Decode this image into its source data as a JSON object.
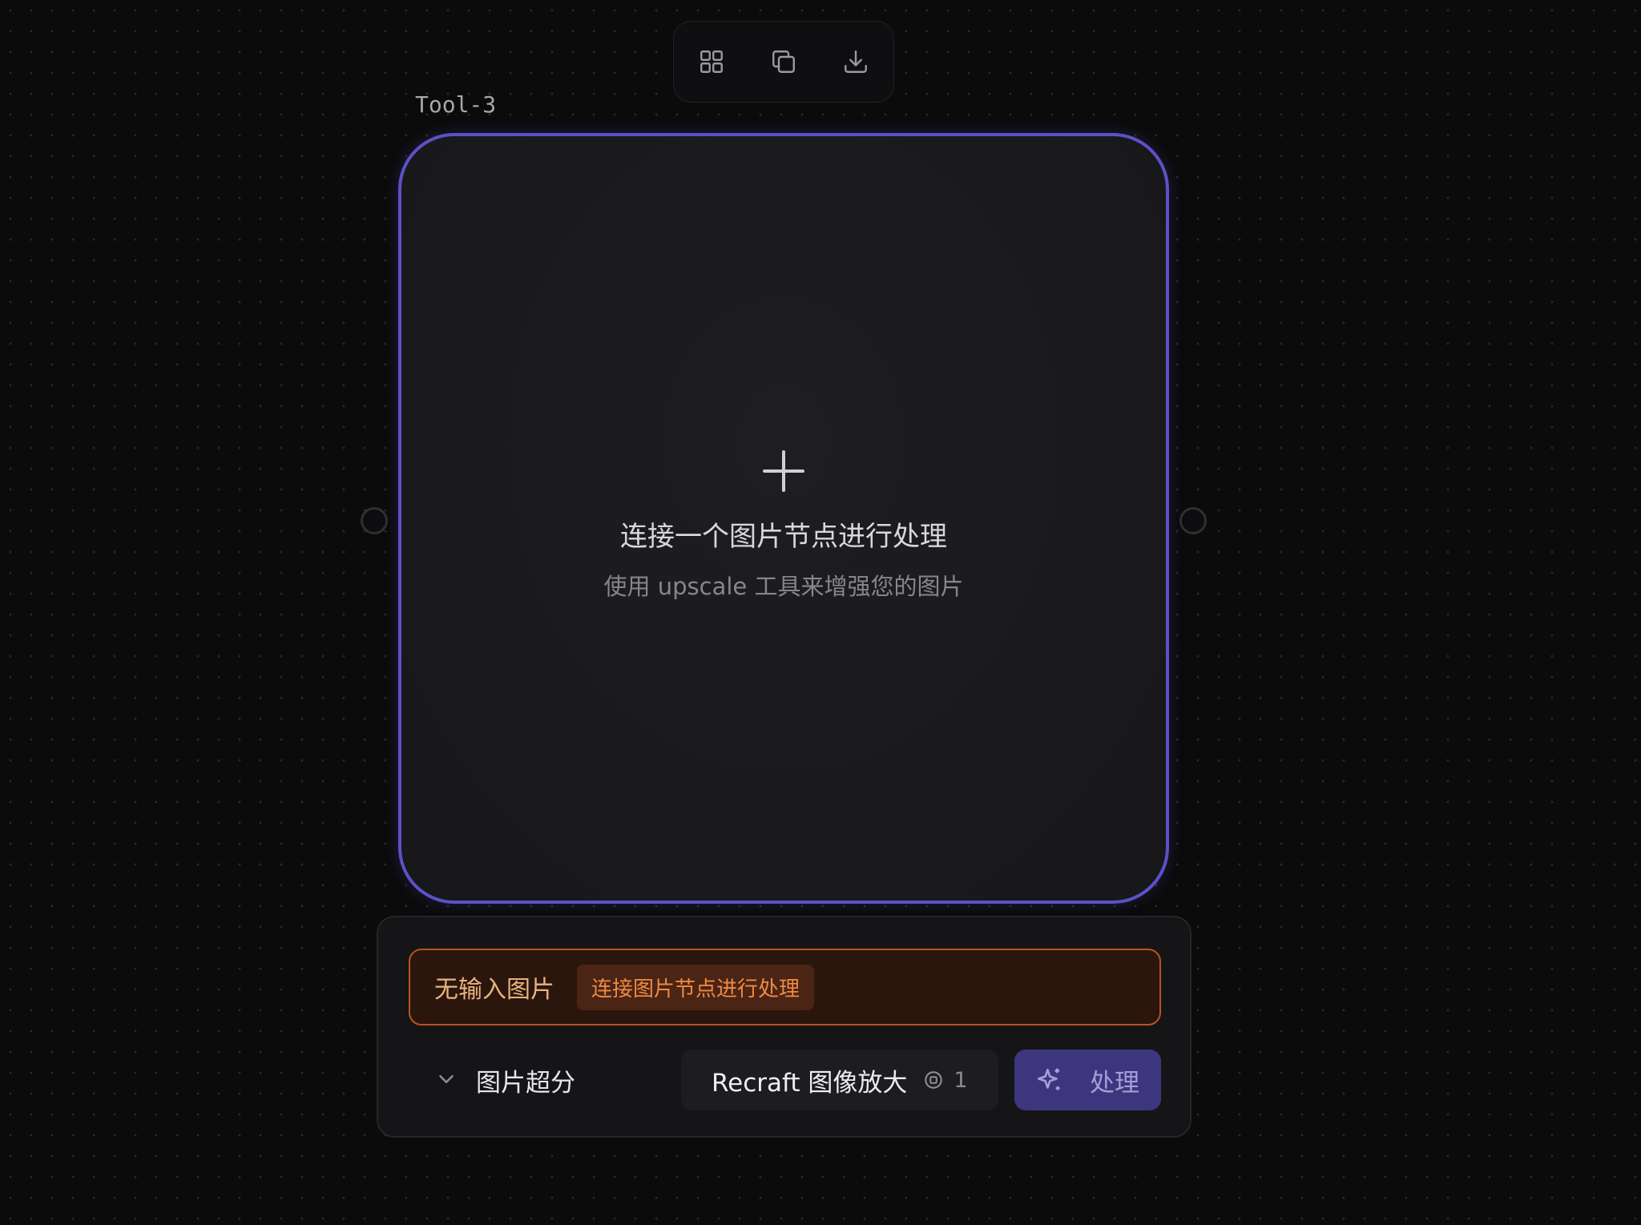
{
  "toolbar": {
    "buttons": [
      {
        "icon": "grid-icon"
      },
      {
        "icon": "duplicate-icon"
      },
      {
        "icon": "download-icon"
      }
    ]
  },
  "node": {
    "label": "Tool-3",
    "accent_color": "#5b51c8",
    "empty_state": {
      "icon": "plus-icon",
      "title": "连接一个图片节点进行处理",
      "subtitle": "使用 upscale 工具来增强您的图片"
    }
  },
  "panel": {
    "warning": {
      "text": "无输入图片",
      "badge": "连接图片节点进行处理",
      "color": "#b8531f"
    },
    "section": {
      "title": "图片超分",
      "expand_icon": "chevron-down-icon"
    },
    "model": {
      "name": "Recraft 图像放大",
      "credit_icon": "credit-icon",
      "credits": "1"
    },
    "process_button": {
      "label": "处理",
      "icon": "sparkle-icon",
      "color": "#3d367e"
    }
  }
}
